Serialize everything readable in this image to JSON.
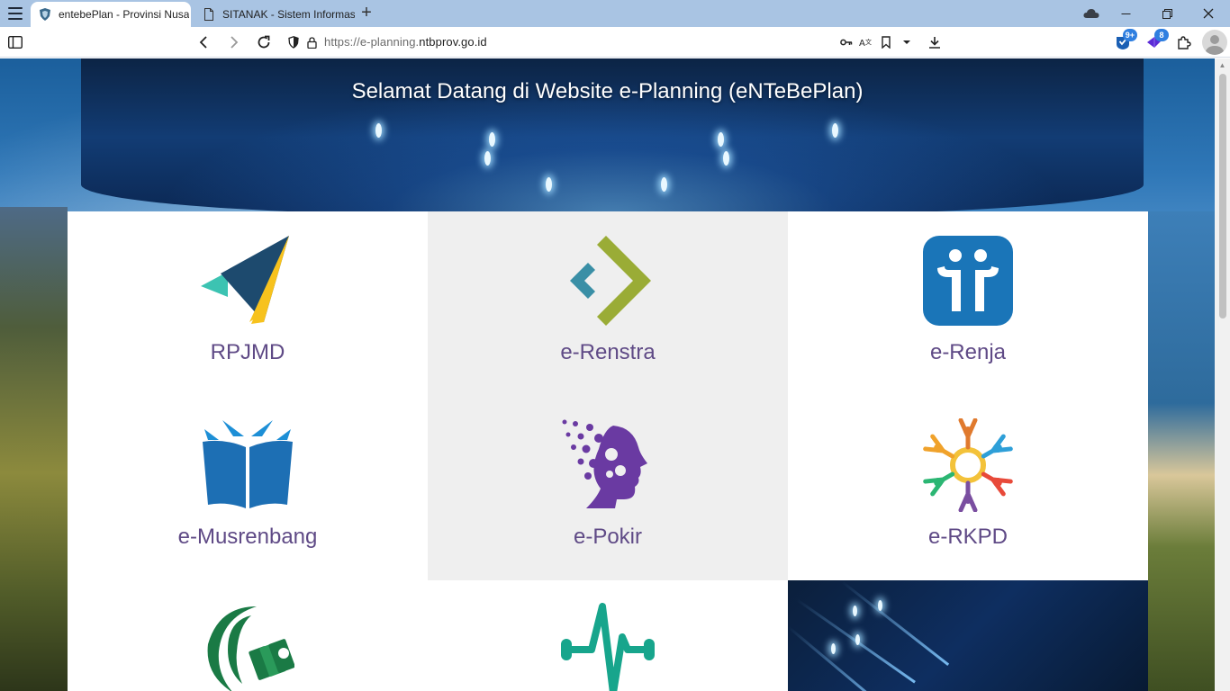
{
  "browser": {
    "tabs": [
      {
        "title": "entebePlan - Provinsi Nusa",
        "active": true
      },
      {
        "title": "SITANAK - Sistem Informas",
        "active": false
      }
    ],
    "url_prefix": "https://e-planning.",
    "url_host": "ntbprov.go.id",
    "badges": {
      "extension_1": "9+",
      "extension_2": "8"
    }
  },
  "page": {
    "welcome_title": "Selamat Datang di Website e-Planning (eNTeBePlan)",
    "apps": [
      {
        "label": "RPJMD",
        "icon": "paper-plane-icon"
      },
      {
        "label": "e-Renstra",
        "icon": "chevrons-icon"
      },
      {
        "label": "e-Renja",
        "icon": "people-icon"
      },
      {
        "label": "e-Musrenbang",
        "icon": "open-book-icon"
      },
      {
        "label": "e-Pokir",
        "icon": "thinking-head-icon"
      },
      {
        "label": "e-RKPD",
        "icon": "people-circle-icon"
      },
      {
        "label": "",
        "icon": "money-crescent-icon"
      },
      {
        "label": "",
        "icon": "pulse-icon"
      }
    ]
  },
  "colors": {
    "label": "#5f4a86",
    "tabstrip": "#a9c4e3",
    "grey_cell": "#efefef"
  }
}
